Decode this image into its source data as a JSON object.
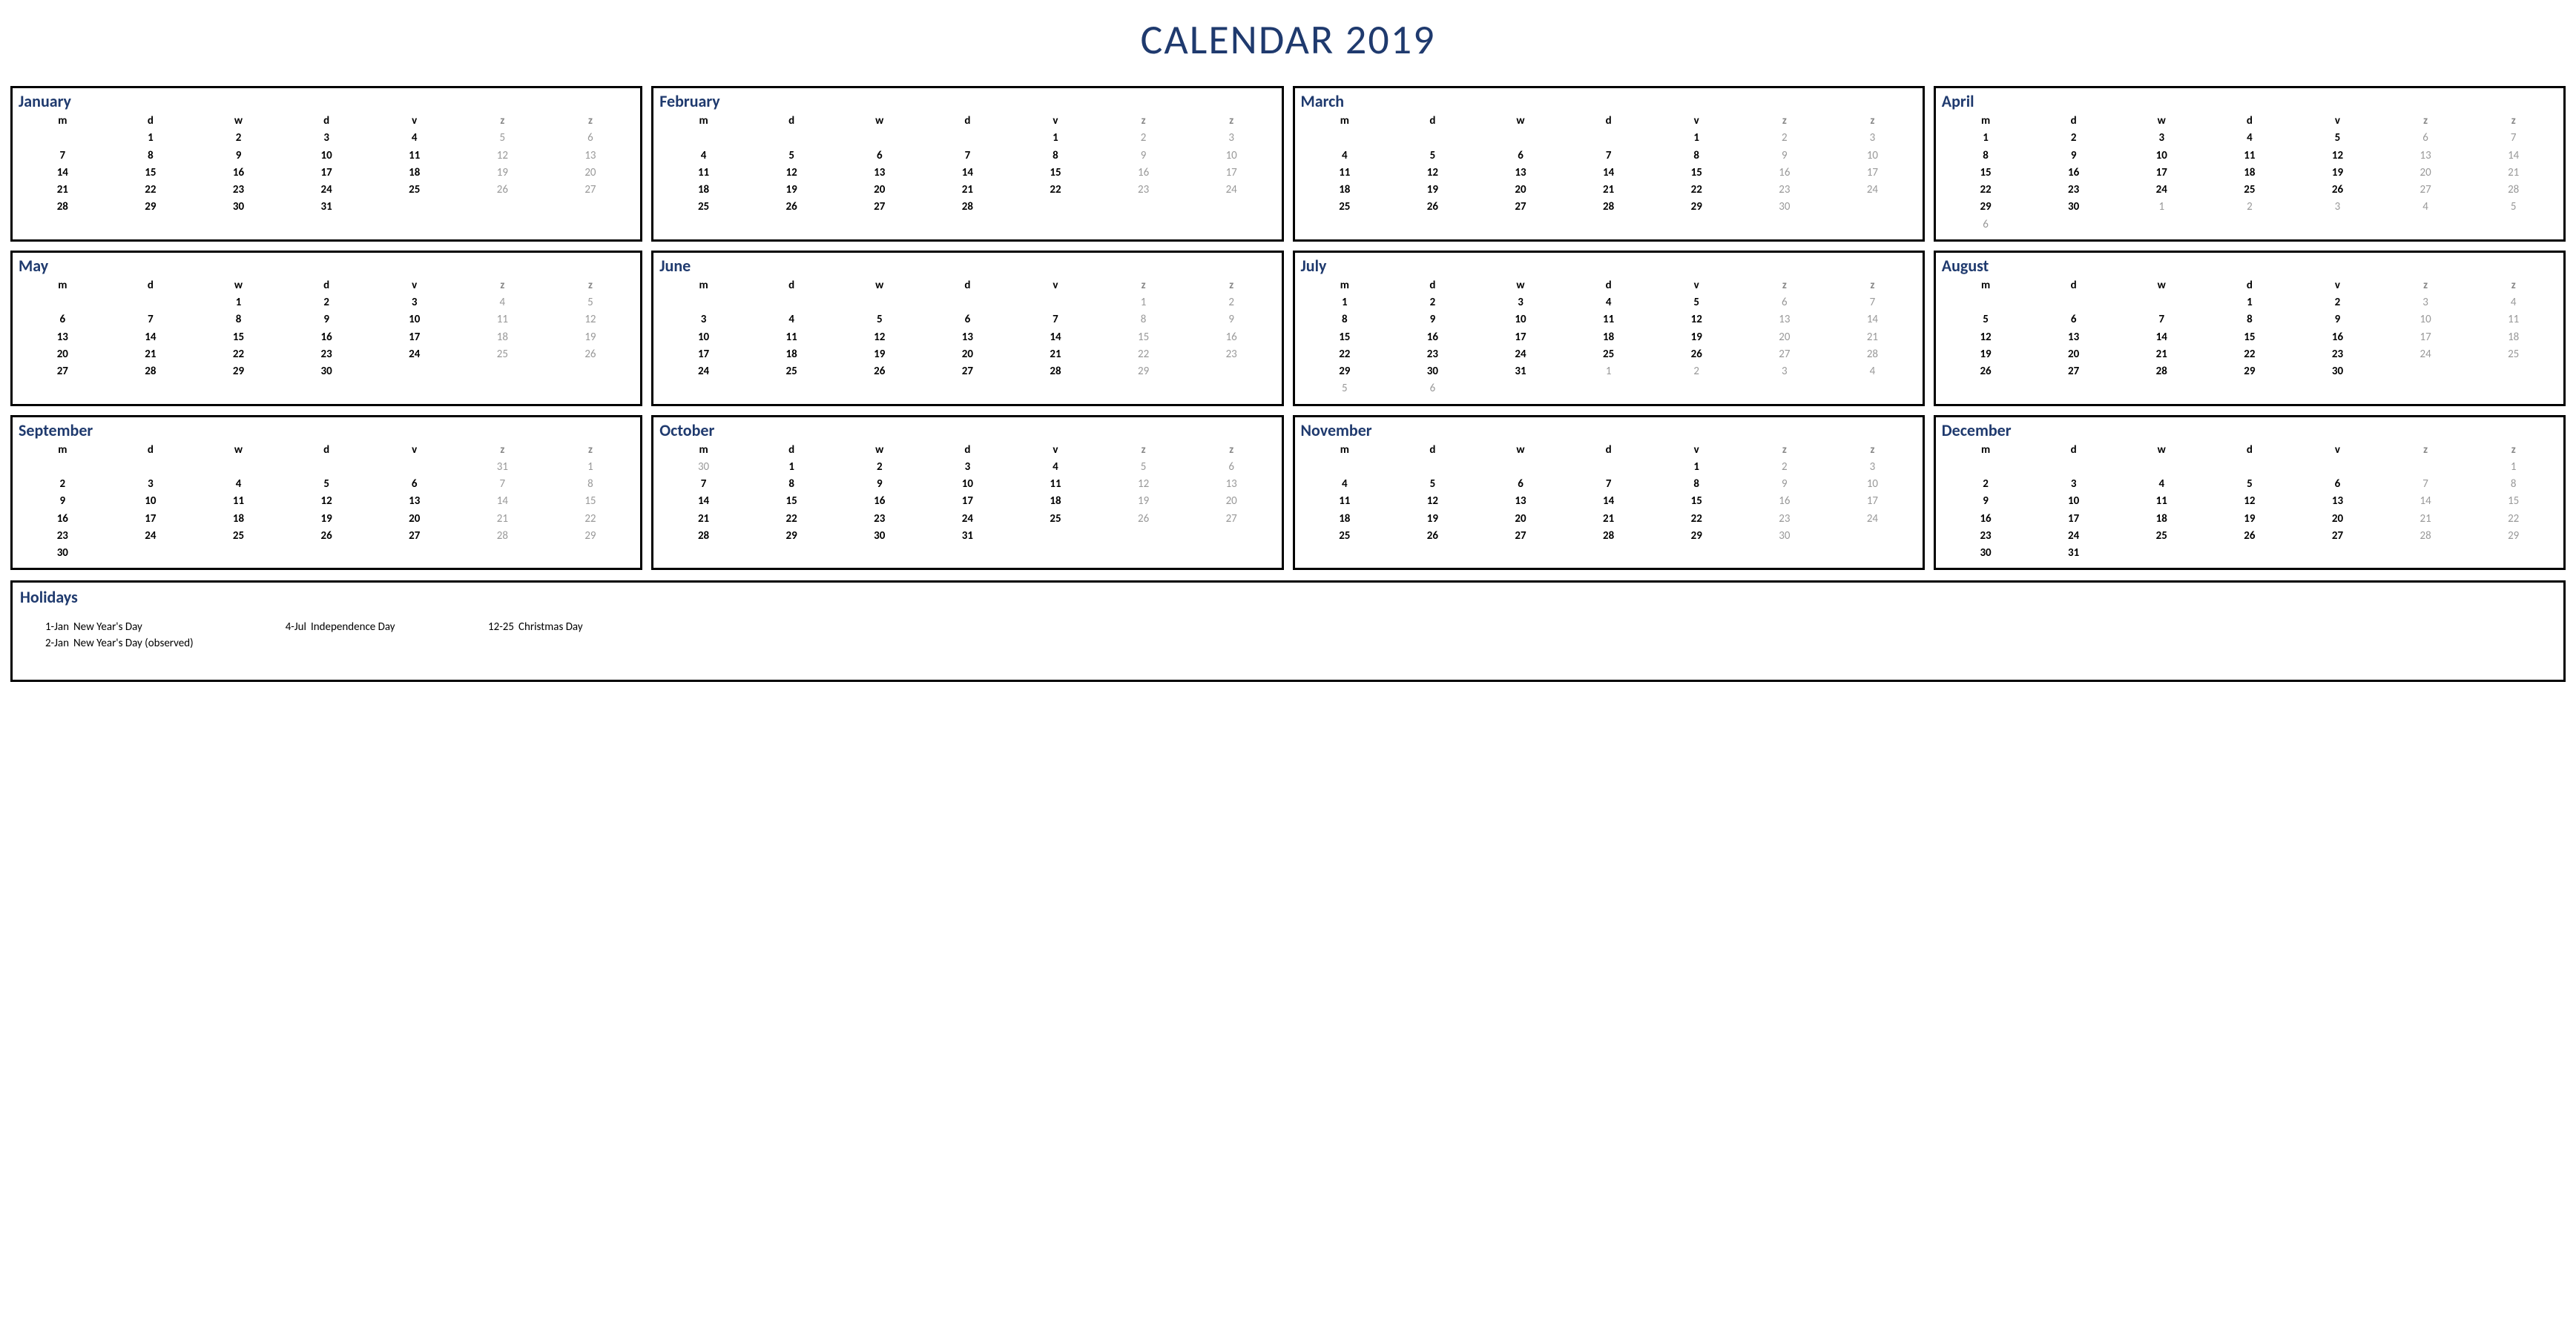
{
  "title": "CALENDAR 2019",
  "dow": [
    "m",
    "d",
    "w",
    "d",
    "v",
    "z",
    "z"
  ],
  "months": [
    {
      "name": "January",
      "weeks": [
        [
          "",
          "1",
          "2",
          "3",
          "4",
          "5",
          "6"
        ],
        [
          "7",
          "8",
          "9",
          "10",
          "11",
          "12",
          "13"
        ],
        [
          "14",
          "15",
          "16",
          "17",
          "18",
          "19",
          "20"
        ],
        [
          "21",
          "22",
          "23",
          "24",
          "25",
          "26",
          "27"
        ],
        [
          "28",
          "29",
          "30",
          "31",
          "",
          "",
          ""
        ]
      ]
    },
    {
      "name": "February",
      "weeks": [
        [
          "",
          "",
          "",
          "",
          "1",
          "2",
          "3"
        ],
        [
          "4",
          "5",
          "6",
          "7",
          "8",
          "9",
          "10"
        ],
        [
          "11",
          "12",
          "13",
          "14",
          "15",
          "16",
          "17"
        ],
        [
          "18",
          "19",
          "20",
          "21",
          "22",
          "23",
          "24"
        ],
        [
          "25",
          "26",
          "27",
          "28",
          "",
          "",
          ""
        ]
      ]
    },
    {
      "name": "March",
      "weeks": [
        [
          "",
          "",
          "",
          "",
          "1",
          "2",
          "3"
        ],
        [
          "4",
          "5",
          "6",
          "7",
          "8",
          "9",
          "10"
        ],
        [
          "11",
          "12",
          "13",
          "14",
          "15",
          "16",
          "17"
        ],
        [
          "18",
          "19",
          "20",
          "21",
          "22",
          "23",
          "24"
        ],
        [
          "25",
          "26",
          "27",
          "28",
          "29",
          "30",
          ""
        ]
      ],
      "outCells": [
        41
      ]
    },
    {
      "name": "April",
      "weeks": [
        [
          "1",
          "2",
          "3",
          "4",
          "5",
          "6",
          "7"
        ],
        [
          "8",
          "9",
          "10",
          "11",
          "12",
          "13",
          "14"
        ],
        [
          "15",
          "16",
          "17",
          "18",
          "19",
          "20",
          "21"
        ],
        [
          "22",
          "23",
          "24",
          "25",
          "26",
          "27",
          "28"
        ],
        [
          "29",
          "30",
          "1",
          "2",
          "3",
          "4",
          "5"
        ],
        [
          "6",
          "",
          "",
          "",
          "",
          "",
          ""
        ]
      ],
      "outCells": [
        30,
        31,
        32,
        33,
        34,
        35
      ]
    },
    {
      "name": "May",
      "weeks": [
        [
          "",
          "",
          "1",
          "2",
          "3",
          "4",
          "5"
        ],
        [
          "6",
          "7",
          "8",
          "9",
          "10",
          "11",
          "12"
        ],
        [
          "13",
          "14",
          "15",
          "16",
          "17",
          "18",
          "19"
        ],
        [
          "20",
          "21",
          "22",
          "23",
          "24",
          "25",
          "26"
        ],
        [
          "27",
          "28",
          "29",
          "30",
          "",
          "",
          ""
        ]
      ],
      "outCells": []
    },
    {
      "name": "June",
      "weeks": [
        [
          "",
          "",
          "",
          "",
          "",
          "1",
          "2"
        ],
        [
          "3",
          "4",
          "5",
          "6",
          "7",
          "8",
          "9"
        ],
        [
          "10",
          "11",
          "12",
          "13",
          "14",
          "15",
          "16"
        ],
        [
          "17",
          "18",
          "19",
          "20",
          "21",
          "22",
          "23"
        ],
        [
          "24",
          "25",
          "26",
          "27",
          "28",
          "29",
          ""
        ]
      ],
      "outCells": [
        33
      ]
    },
    {
      "name": "July",
      "weeks": [
        [
          "1",
          "2",
          "3",
          "4",
          "5",
          "6",
          "7"
        ],
        [
          "8",
          "9",
          "10",
          "11",
          "12",
          "13",
          "14"
        ],
        [
          "15",
          "16",
          "17",
          "18",
          "19",
          "20",
          "21"
        ],
        [
          "22",
          "23",
          "24",
          "25",
          "26",
          "27",
          "28"
        ],
        [
          "29",
          "30",
          "31",
          "1",
          "2",
          "3",
          "4"
        ],
        [
          "5",
          "6",
          "",
          "",
          "",
          "",
          ""
        ]
      ],
      "outCells": [
        31,
        32,
        33,
        34,
        35,
        36
      ]
    },
    {
      "name": "August",
      "weeks": [
        [
          "",
          "",
          "",
          "1",
          "2",
          "3",
          "4"
        ],
        [
          "5",
          "6",
          "7",
          "8",
          "9",
          "10",
          "11"
        ],
        [
          "12",
          "13",
          "14",
          "15",
          "16",
          "17",
          "18"
        ],
        [
          "19",
          "20",
          "21",
          "22",
          "23",
          "24",
          "25"
        ],
        [
          "26",
          "27",
          "28",
          "29",
          "30",
          "",
          ""
        ]
      ]
    },
    {
      "name": "September",
      "weeks": [
        [
          "",
          "",
          "",
          "",
          "",
          "31",
          "1"
        ],
        [
          "2",
          "3",
          "4",
          "5",
          "6",
          "7",
          "8"
        ],
        [
          "9",
          "10",
          "11",
          "12",
          "13",
          "14",
          "15"
        ],
        [
          "16",
          "17",
          "18",
          "19",
          "20",
          "21",
          "22"
        ],
        [
          "23",
          "24",
          "25",
          "26",
          "27",
          "28",
          "29"
        ],
        [
          "30",
          "",
          "",
          "",
          "",
          "",
          ""
        ]
      ],
      "outCells": [
        5
      ]
    },
    {
      "name": "October",
      "weeks": [
        [
          "30",
          "1",
          "2",
          "3",
          "4",
          "5",
          "6"
        ],
        [
          "7",
          "8",
          "9",
          "10",
          "11",
          "12",
          "13"
        ],
        [
          "14",
          "15",
          "16",
          "17",
          "18",
          "19",
          "20"
        ],
        [
          "21",
          "22",
          "23",
          "24",
          "25",
          "26",
          "27"
        ],
        [
          "28",
          "29",
          "30",
          "31",
          "",
          "",
          ""
        ]
      ],
      "outCells": [
        0
      ]
    },
    {
      "name": "November",
      "weeks": [
        [
          "",
          "",
          "",
          "",
          "1",
          "2",
          "3"
        ],
        [
          "4",
          "5",
          "6",
          "7",
          "8",
          "9",
          "10"
        ],
        [
          "11",
          "12",
          "13",
          "14",
          "15",
          "16",
          "17"
        ],
        [
          "18",
          "19",
          "20",
          "21",
          "22",
          "23",
          "24"
        ],
        [
          "25",
          "26",
          "27",
          "28",
          "29",
          "30",
          ""
        ]
      ],
      "outCells": [
        34
      ]
    },
    {
      "name": "December",
      "weeks": [
        [
          "",
          "",
          "",
          "",
          "",
          "",
          "1"
        ],
        [
          "2",
          "3",
          "4",
          "5",
          "6",
          "7",
          "8"
        ],
        [
          "9",
          "10",
          "11",
          "12",
          "13",
          "14",
          "15"
        ],
        [
          "16",
          "17",
          "18",
          "19",
          "20",
          "21",
          "22"
        ],
        [
          "23",
          "24",
          "25",
          "26",
          "27",
          "28",
          "29"
        ],
        [
          "30",
          "31",
          "",
          "",
          "",
          "",
          ""
        ]
      ]
    }
  ],
  "holidays": {
    "title": "Holidays",
    "items": [
      {
        "date": "1-Jan",
        "label": "New Year's Day",
        "col": 0
      },
      {
        "date": "2-Jan",
        "label": "New Year's Day (observed)",
        "col": 0
      },
      {
        "date": "4-Jul",
        "label": "Independence Day",
        "col": 1
      },
      {
        "date": "12-25",
        "label": "Christmas Day",
        "col": 2
      }
    ]
  }
}
